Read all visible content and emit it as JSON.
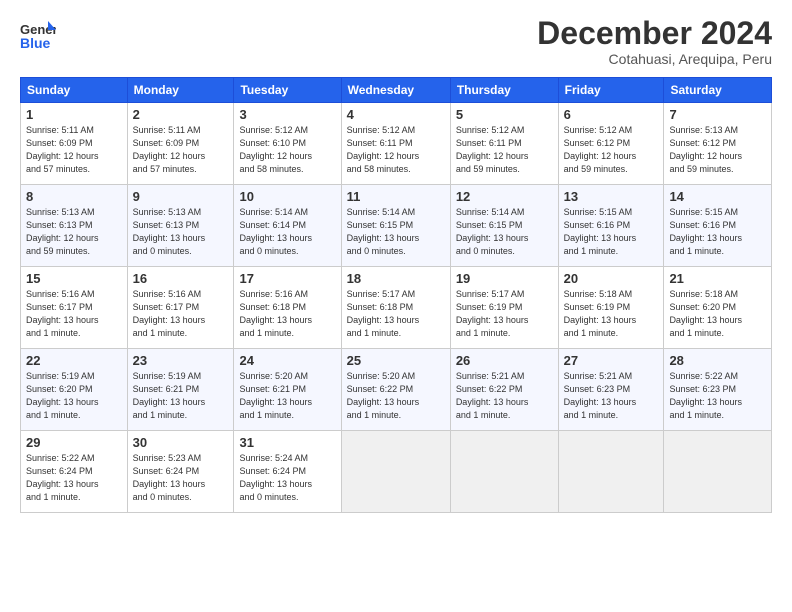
{
  "logo": {
    "general": "General",
    "blue": "Blue"
  },
  "title": "December 2024",
  "location": "Cotahuasi, Arequipa, Peru",
  "headers": [
    "Sunday",
    "Monday",
    "Tuesday",
    "Wednesday",
    "Thursday",
    "Friday",
    "Saturday"
  ],
  "weeks": [
    [
      {
        "day": "1",
        "info": "Sunrise: 5:11 AM\nSunset: 6:09 PM\nDaylight: 12 hours\nand 57 minutes."
      },
      {
        "day": "2",
        "info": "Sunrise: 5:11 AM\nSunset: 6:09 PM\nDaylight: 12 hours\nand 57 minutes."
      },
      {
        "day": "3",
        "info": "Sunrise: 5:12 AM\nSunset: 6:10 PM\nDaylight: 12 hours\nand 58 minutes."
      },
      {
        "day": "4",
        "info": "Sunrise: 5:12 AM\nSunset: 6:11 PM\nDaylight: 12 hours\nand 58 minutes."
      },
      {
        "day": "5",
        "info": "Sunrise: 5:12 AM\nSunset: 6:11 PM\nDaylight: 12 hours\nand 59 minutes."
      },
      {
        "day": "6",
        "info": "Sunrise: 5:12 AM\nSunset: 6:12 PM\nDaylight: 12 hours\nand 59 minutes."
      },
      {
        "day": "7",
        "info": "Sunrise: 5:13 AM\nSunset: 6:12 PM\nDaylight: 12 hours\nand 59 minutes."
      }
    ],
    [
      {
        "day": "8",
        "info": "Sunrise: 5:13 AM\nSunset: 6:13 PM\nDaylight: 12 hours\nand 59 minutes."
      },
      {
        "day": "9",
        "info": "Sunrise: 5:13 AM\nSunset: 6:13 PM\nDaylight: 13 hours\nand 0 minutes."
      },
      {
        "day": "10",
        "info": "Sunrise: 5:14 AM\nSunset: 6:14 PM\nDaylight: 13 hours\nand 0 minutes."
      },
      {
        "day": "11",
        "info": "Sunrise: 5:14 AM\nSunset: 6:15 PM\nDaylight: 13 hours\nand 0 minutes."
      },
      {
        "day": "12",
        "info": "Sunrise: 5:14 AM\nSunset: 6:15 PM\nDaylight: 13 hours\nand 0 minutes."
      },
      {
        "day": "13",
        "info": "Sunrise: 5:15 AM\nSunset: 6:16 PM\nDaylight: 13 hours\nand 1 minute."
      },
      {
        "day": "14",
        "info": "Sunrise: 5:15 AM\nSunset: 6:16 PM\nDaylight: 13 hours\nand 1 minute."
      }
    ],
    [
      {
        "day": "15",
        "info": "Sunrise: 5:16 AM\nSunset: 6:17 PM\nDaylight: 13 hours\nand 1 minute."
      },
      {
        "day": "16",
        "info": "Sunrise: 5:16 AM\nSunset: 6:17 PM\nDaylight: 13 hours\nand 1 minute."
      },
      {
        "day": "17",
        "info": "Sunrise: 5:16 AM\nSunset: 6:18 PM\nDaylight: 13 hours\nand 1 minute."
      },
      {
        "day": "18",
        "info": "Sunrise: 5:17 AM\nSunset: 6:18 PM\nDaylight: 13 hours\nand 1 minute."
      },
      {
        "day": "19",
        "info": "Sunrise: 5:17 AM\nSunset: 6:19 PM\nDaylight: 13 hours\nand 1 minute."
      },
      {
        "day": "20",
        "info": "Sunrise: 5:18 AM\nSunset: 6:19 PM\nDaylight: 13 hours\nand 1 minute."
      },
      {
        "day": "21",
        "info": "Sunrise: 5:18 AM\nSunset: 6:20 PM\nDaylight: 13 hours\nand 1 minute."
      }
    ],
    [
      {
        "day": "22",
        "info": "Sunrise: 5:19 AM\nSunset: 6:20 PM\nDaylight: 13 hours\nand 1 minute."
      },
      {
        "day": "23",
        "info": "Sunrise: 5:19 AM\nSunset: 6:21 PM\nDaylight: 13 hours\nand 1 minute."
      },
      {
        "day": "24",
        "info": "Sunrise: 5:20 AM\nSunset: 6:21 PM\nDaylight: 13 hours\nand 1 minute."
      },
      {
        "day": "25",
        "info": "Sunrise: 5:20 AM\nSunset: 6:22 PM\nDaylight: 13 hours\nand 1 minute."
      },
      {
        "day": "26",
        "info": "Sunrise: 5:21 AM\nSunset: 6:22 PM\nDaylight: 13 hours\nand 1 minute."
      },
      {
        "day": "27",
        "info": "Sunrise: 5:21 AM\nSunset: 6:23 PM\nDaylight: 13 hours\nand 1 minute."
      },
      {
        "day": "28",
        "info": "Sunrise: 5:22 AM\nSunset: 6:23 PM\nDaylight: 13 hours\nand 1 minute."
      }
    ],
    [
      {
        "day": "29",
        "info": "Sunrise: 5:22 AM\nSunset: 6:24 PM\nDaylight: 13 hours\nand 1 minute."
      },
      {
        "day": "30",
        "info": "Sunrise: 5:23 AM\nSunset: 6:24 PM\nDaylight: 13 hours\nand 0 minutes."
      },
      {
        "day": "31",
        "info": "Sunrise: 5:24 AM\nSunset: 6:24 PM\nDaylight: 13 hours\nand 0 minutes."
      },
      {
        "day": "",
        "info": ""
      },
      {
        "day": "",
        "info": ""
      },
      {
        "day": "",
        "info": ""
      },
      {
        "day": "",
        "info": ""
      }
    ]
  ]
}
